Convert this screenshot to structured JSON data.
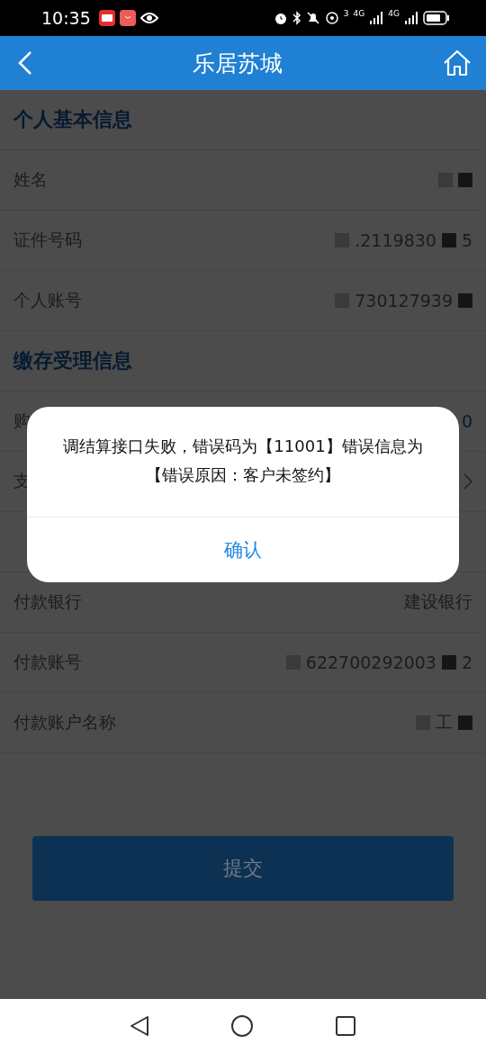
{
  "status_bar": {
    "time": "10:35",
    "network_labels": [
      "3",
      "4G",
      "4G"
    ]
  },
  "nav": {
    "title": "乐居苏城"
  },
  "sections": [
    {
      "kind": "header",
      "title": "个人基本信息"
    },
    {
      "kind": "row",
      "label": "姓名",
      "redacted": true
    },
    {
      "kind": "row",
      "label": "证件号码",
      "value": ".2119830",
      "tail": "5",
      "redacted": true
    },
    {
      "kind": "row",
      "label": "个人账号",
      "value": "730127939",
      "redacted": true
    },
    {
      "kind": "header",
      "title": "缴存受理信息"
    },
    {
      "kind": "row",
      "label": "购",
      "value": "0",
      "link": true
    },
    {
      "kind": "row",
      "label": "支",
      "chevron": true
    },
    {
      "kind": "header"
    },
    {
      "kind": "row",
      "label": "付款银行",
      "value": "建设银行"
    },
    {
      "kind": "row",
      "label": "付款账号",
      "value": "622700292003",
      "tail": "2",
      "redacted": true
    },
    {
      "kind": "row",
      "label": "付款账户名称",
      "value": "工",
      "redacted": true
    }
  ],
  "submit": {
    "label": "提交",
    "disabled": true
  },
  "dialog": {
    "message": "调结算接口失败，错误码为【11001】错误信息为【错误原因：客户未签约】",
    "confirm": "确认"
  }
}
